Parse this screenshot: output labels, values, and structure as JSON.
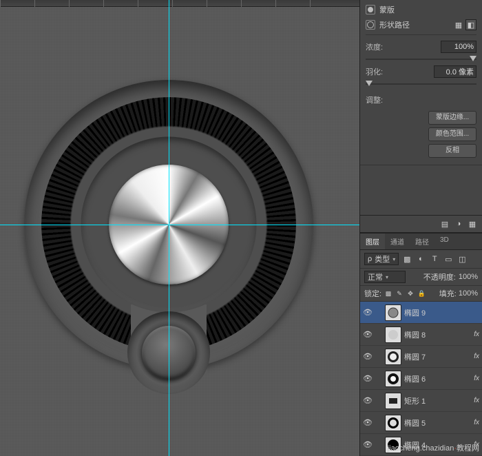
{
  "masks": {
    "tab_label": "蒙版",
    "shape_path_label": "形状路径",
    "density_label": "浓度:",
    "density_value": "100%",
    "feather_label": "羽化:",
    "feather_value": "0.0 像素",
    "adjust_label": "调整:",
    "btn_mask_edge": "蒙版边缘...",
    "btn_color_range": "颜色范围...",
    "btn_invert": "反相"
  },
  "layers_panel": {
    "tab_layers": "图层",
    "tab_channels": "通道",
    "tab_paths": "路径",
    "tab_3d": "3D",
    "filter_label": "类型",
    "blend_mode": "正常",
    "opacity_label": "不透明度:",
    "opacity_value": "100%",
    "lock_label": "锁定:",
    "fill_label": "填充:",
    "fill_value": "100%"
  },
  "layers": [
    {
      "name": "椭圆 9",
      "selected": true,
      "fx": ""
    },
    {
      "name": "椭圆 8",
      "selected": false,
      "fx": "f"
    },
    {
      "name": "椭圆 7",
      "selected": false,
      "fx": "f"
    },
    {
      "name": "椭圆 6",
      "selected": false,
      "fx": "f"
    },
    {
      "name": "矩形 1",
      "selected": false,
      "fx": "f"
    },
    {
      "name": "椭圆 5",
      "selected": false,
      "fx": "f"
    },
    {
      "name": "椭圆 4",
      "selected": false,
      "fx": "f"
    }
  ],
  "watermark": {
    "text": "jiaocheng.chazidian",
    "suffix": "网",
    "dot": "·"
  }
}
